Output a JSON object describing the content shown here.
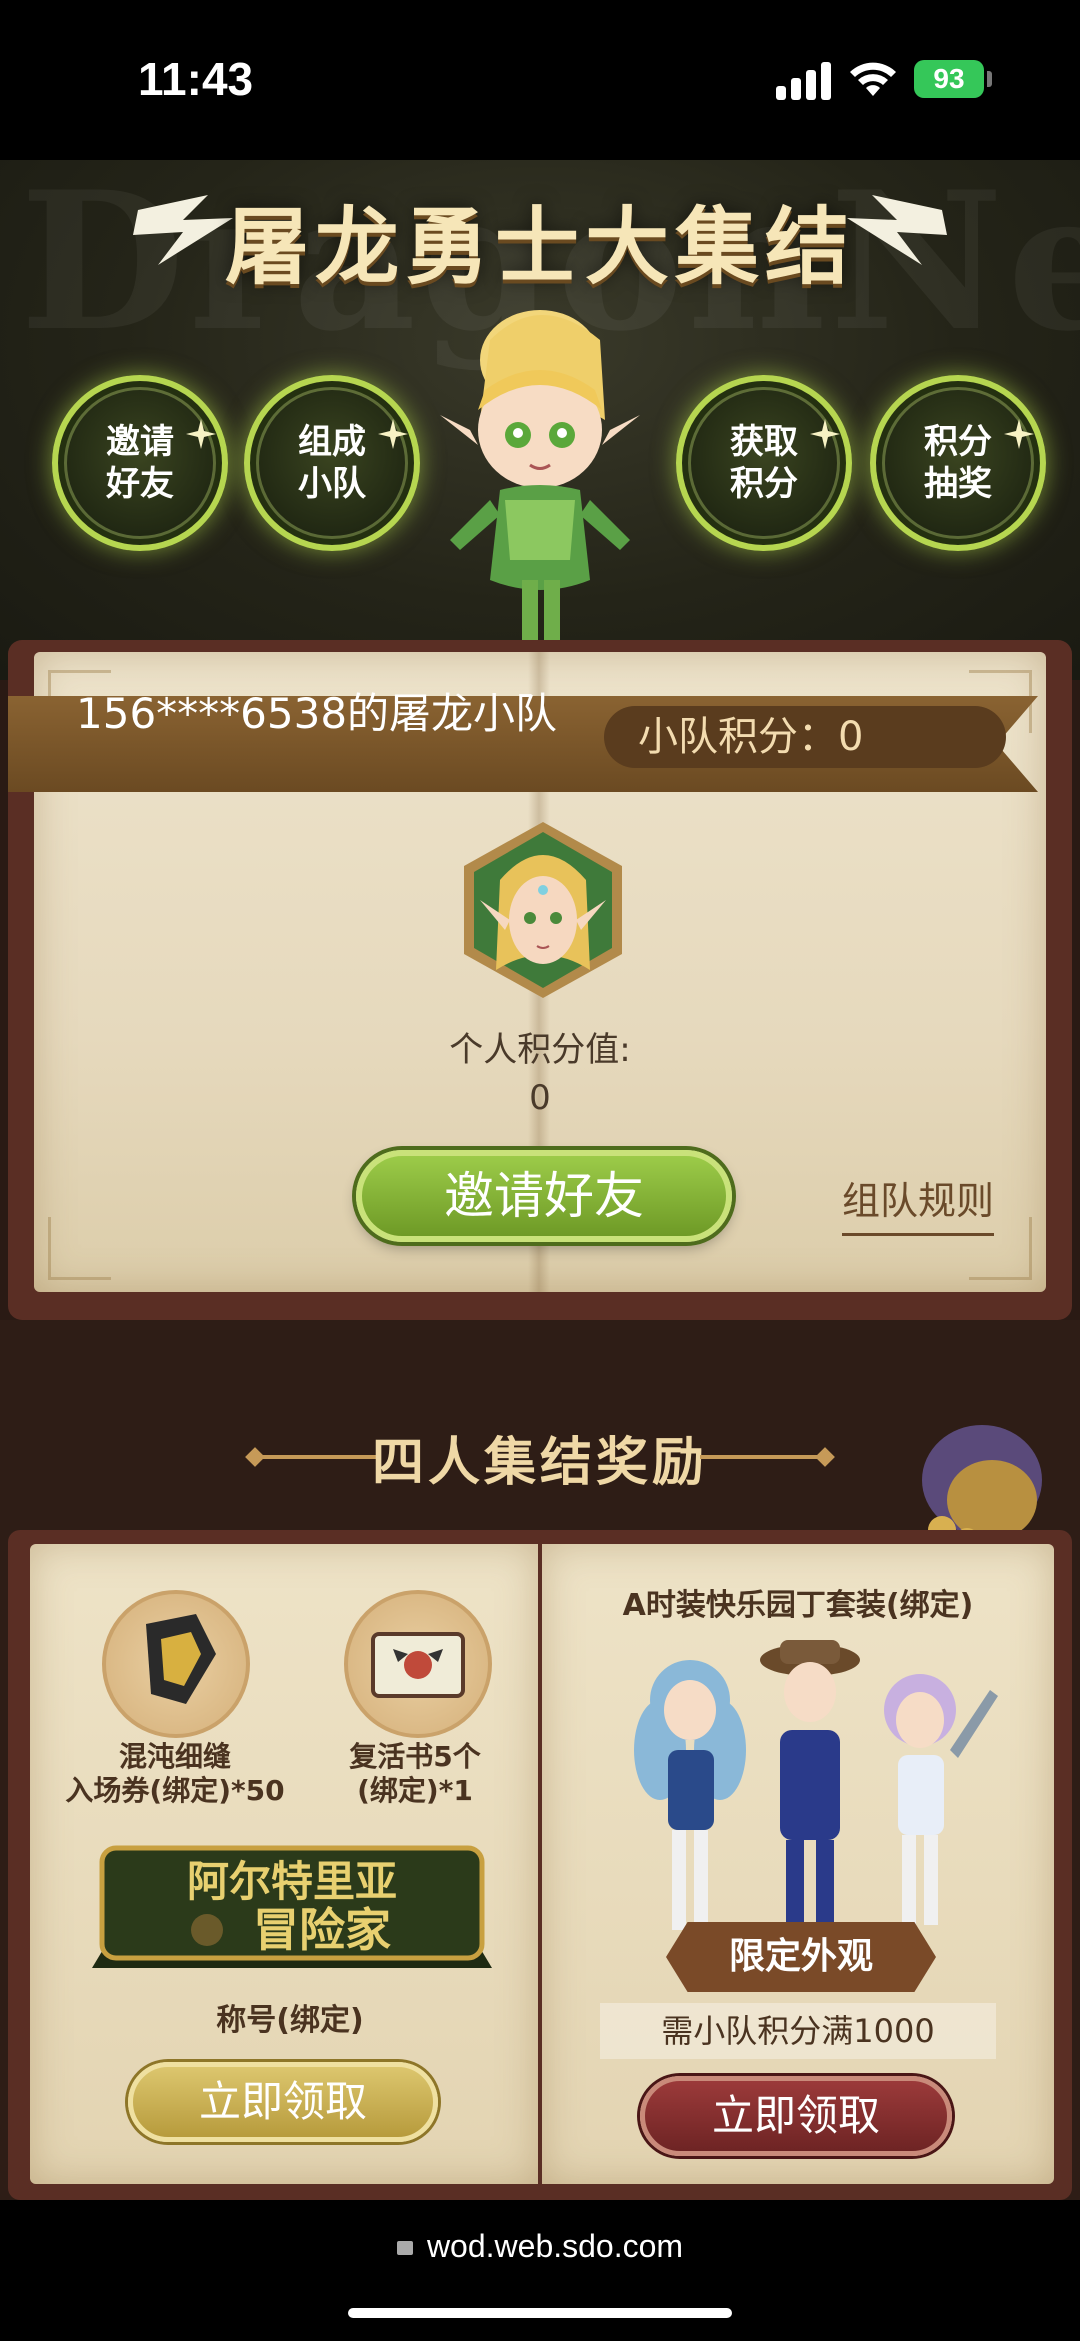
{
  "status_bar": {
    "time": "11:43",
    "battery": "93"
  },
  "hero": {
    "watermark": "DragonNest",
    "title": "屠龙勇士大集结",
    "features": [
      {
        "label": "邀请\n好友"
      },
      {
        "label": "组成\n小队"
      },
      {
        "label": "获取\n积分"
      },
      {
        "label": "积分\n抽奖"
      }
    ]
  },
  "team": {
    "name": "156****6538的屠龙小队",
    "score_label": "小队积分：0",
    "personal_points_label": "个人积分值:",
    "personal_points_value": "0",
    "invite_button": "邀请好友",
    "rules_link": "组队规则"
  },
  "rewards": {
    "section_title": "四人集结奖励",
    "left": {
      "items": [
        {
          "name": "混沌细缝\n入场券(绑定)*50"
        },
        {
          "name": "复活书5个\n(绑定)*1"
        }
      ],
      "badge_text_line1": "阿尔特里亚",
      "badge_text_line2": "冒险家",
      "badge_caption": "称号(绑定)",
      "claim_button": "立即领取"
    },
    "right": {
      "outfit_title": "A时装快乐园丁套装(绑定)",
      "limited_tag": "限定外观",
      "requirement": "需小队积分满1000",
      "claim_button": "立即领取"
    }
  },
  "browser": {
    "url": "wod.web.sdo.com"
  },
  "colors": {
    "accent_green": "#9ccb49",
    "gold": "#c69a58",
    "claim_red": "#9b3a3a"
  }
}
